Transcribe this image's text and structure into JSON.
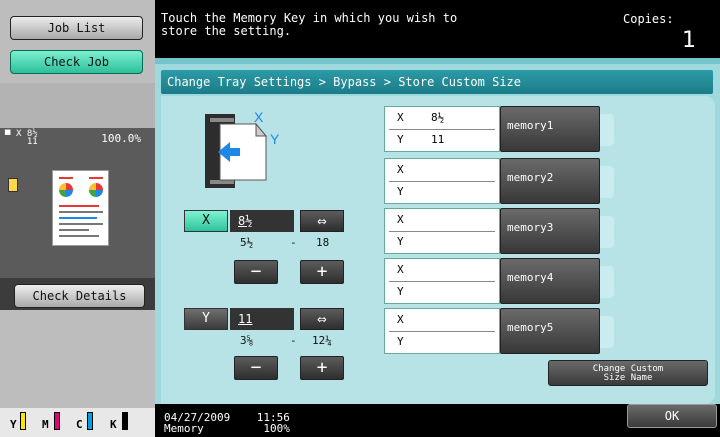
{
  "sidebar": {
    "job_list": "Job List",
    "check_job": "Check Job",
    "preview_size_top": "8½",
    "preview_size_bottom": "11",
    "preview_x": "X",
    "zoom": "100.0%",
    "check_details": "Check Details",
    "toner": [
      "Y",
      "M",
      "C",
      "K"
    ]
  },
  "header": {
    "message": "Touch the Memory Key in which you wish to\nstore the setting.",
    "copies_label": "Copies:",
    "copies_value": "1"
  },
  "breadcrumb": "Change Tray Settings > Bypass > Store Custom Size",
  "diagram": {
    "x_label": "X",
    "y_label": "Y"
  },
  "x_control": {
    "label": "X",
    "value": "8½",
    "min": "5½",
    "dash": "-",
    "max": "18",
    "swap": "⇔",
    "minus": "−",
    "plus": "+"
  },
  "y_control": {
    "label": "Y",
    "value": "11",
    "min": "3⅝",
    "dash": "-",
    "max": "12¼",
    "swap": "⇔",
    "minus": "−",
    "plus": "+"
  },
  "memories": [
    {
      "x_label": "X",
      "y_label": "Y",
      "x": "8½",
      "y": "11",
      "name": "memory1"
    },
    {
      "x_label": "X",
      "y_label": "Y",
      "x": "",
      "y": "",
      "name": "memory2"
    },
    {
      "x_label": "X",
      "y_label": "Y",
      "x": "",
      "y": "",
      "name": "memory3"
    },
    {
      "x_label": "X",
      "y_label": "Y",
      "x": "",
      "y": "",
      "name": "memory4"
    },
    {
      "x_label": "X",
      "y_label": "Y",
      "x": "",
      "y": "",
      "name": "memory5"
    }
  ],
  "change_name": {
    "line1": "Change Custom",
    "line2": "Size Name"
  },
  "footer": {
    "datetime": "04/27/2009    11:56\nMemory         100%",
    "ok": "OK"
  },
  "colors": {
    "panel": "#9fd8dd",
    "breadcrumb": "#1b7c88",
    "active": "#2dc29d",
    "arrow": "#1e88e5"
  }
}
